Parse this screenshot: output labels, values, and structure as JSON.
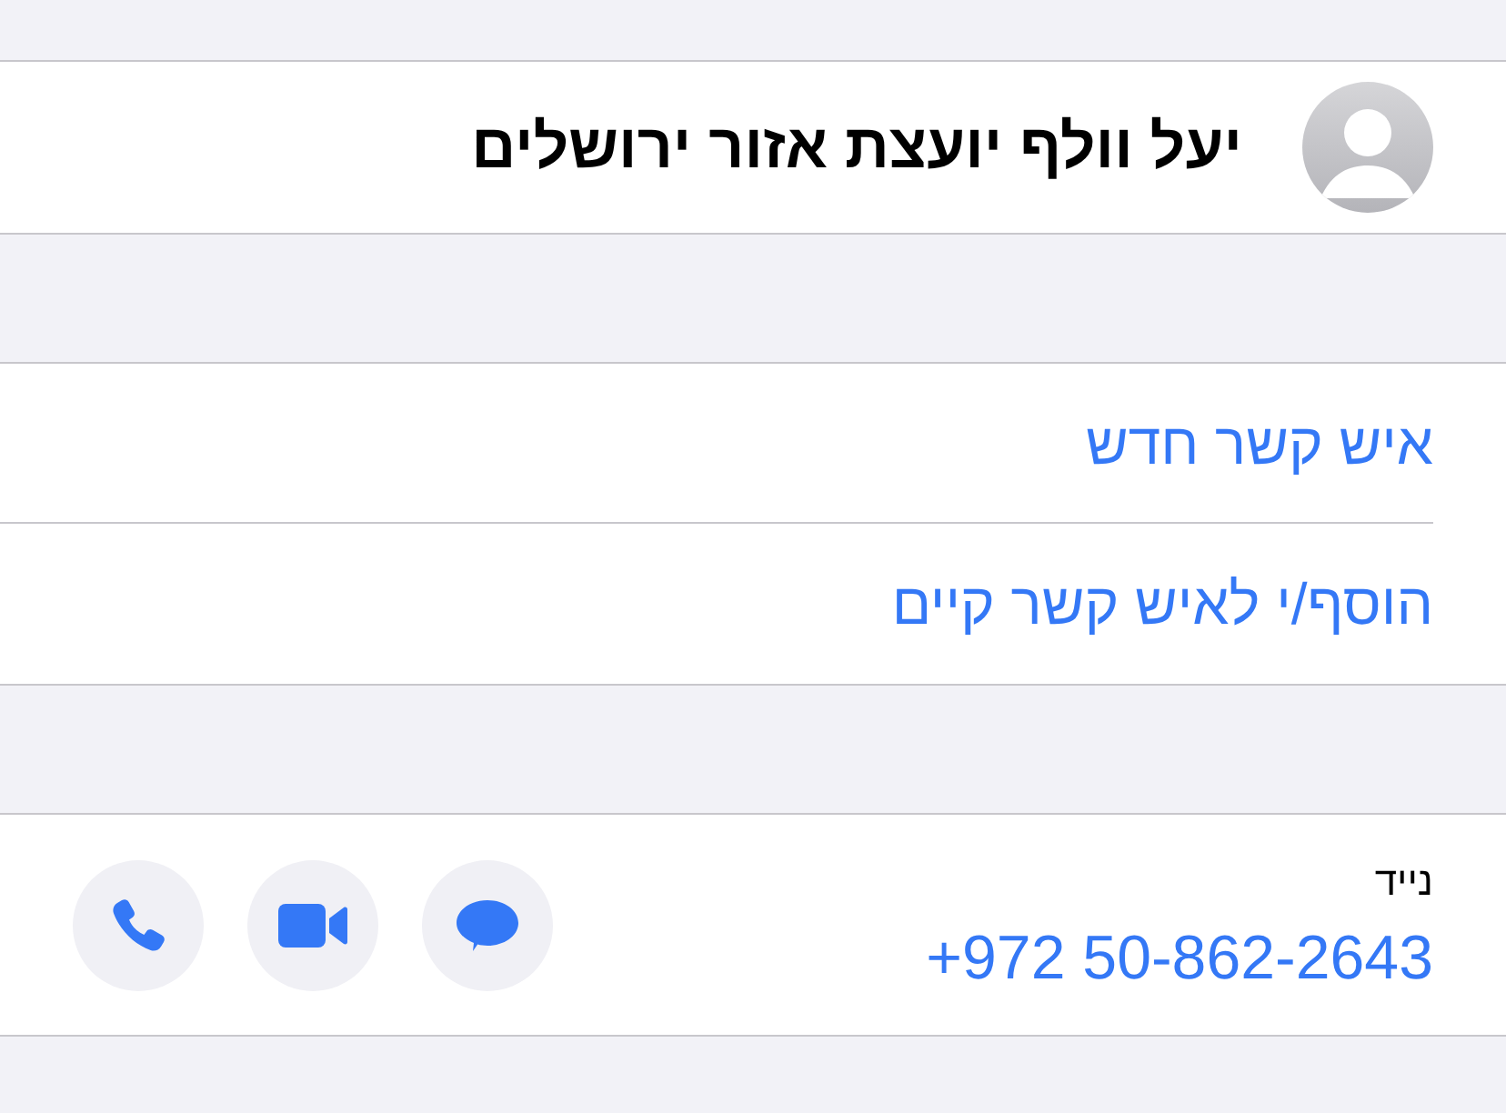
{
  "contact": {
    "name": "יעל וולף יועצת אזור ירושלים"
  },
  "actions": [
    {
      "label": "איש קשר חדש"
    },
    {
      "label": "הוסף/י לאיש קשר קיים"
    }
  ],
  "phone": {
    "label": "נייד",
    "number": "+972 50-862-2643",
    "buttons": [
      {
        "kind": "message"
      },
      {
        "kind": "video"
      },
      {
        "kind": "call"
      }
    ]
  }
}
